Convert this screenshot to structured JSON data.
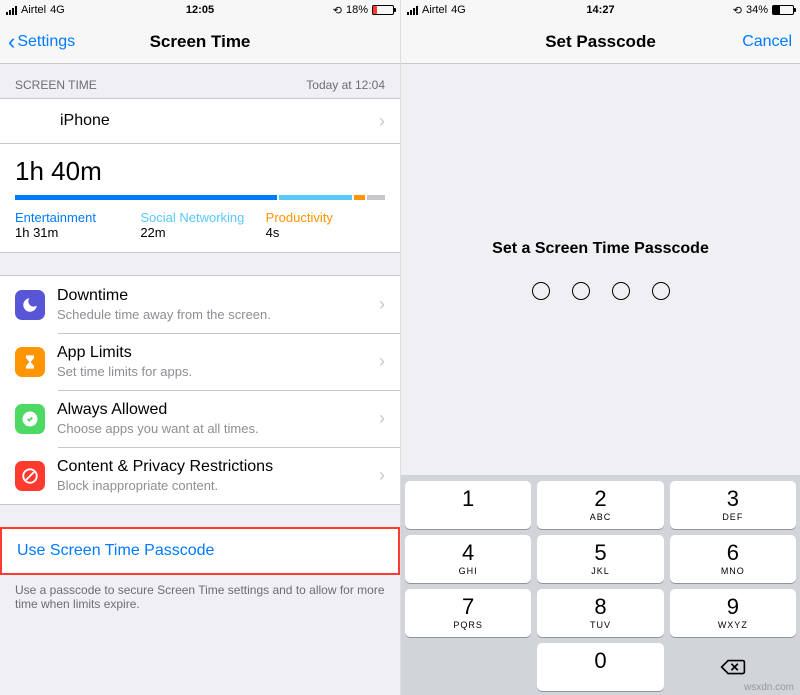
{
  "left": {
    "status": {
      "carrier": "Airtel",
      "net": "4G",
      "time": "12:05",
      "battery_pct": "18%"
    },
    "nav": {
      "back": "Settings",
      "title": "Screen Time"
    },
    "section": {
      "header": "SCREEN TIME",
      "timestamp": "Today at 12:04"
    },
    "device_row": {
      "label": "iPhone"
    },
    "usage": {
      "total": "1h 40m",
      "cats": [
        {
          "label": "Entertainment",
          "value": "1h 31m",
          "color": "#007aff",
          "flex": 72
        },
        {
          "label": "Social Networking",
          "value": "22m",
          "color": "#5ac8fa",
          "flex": 20
        },
        {
          "label": "Productivity",
          "value": "4s",
          "color": "#ff9500",
          "flex": 3
        }
      ]
    },
    "menu": [
      {
        "title": "Downtime",
        "sub": "Schedule time away from the screen.",
        "icon": "moon-icon",
        "color": "ico-purple"
      },
      {
        "title": "App Limits",
        "sub": "Set time limits for apps.",
        "icon": "hourglass-icon",
        "color": "ico-orange"
      },
      {
        "title": "Always Allowed",
        "sub": "Choose apps you want at all times.",
        "icon": "check-badge-icon",
        "color": "ico-green"
      },
      {
        "title": "Content & Privacy Restrictions",
        "sub": "Block inappropriate content.",
        "icon": "prohibited-icon",
        "color": "ico-red"
      }
    ],
    "passcode_link": "Use Screen Time Passcode",
    "passcode_footer": "Use a passcode to secure Screen Time settings and to allow for more time when limits expire."
  },
  "right": {
    "status": {
      "carrier": "Airtel",
      "net": "4G",
      "time": "14:27",
      "battery_pct": "34%"
    },
    "nav": {
      "title": "Set Passcode",
      "cancel": "Cancel"
    },
    "prompt": "Set a Screen Time Passcode",
    "keypad": [
      [
        {
          "n": "1",
          "l": ""
        },
        {
          "n": "2",
          "l": "ABC"
        },
        {
          "n": "3",
          "l": "DEF"
        }
      ],
      [
        {
          "n": "4",
          "l": "GHI"
        },
        {
          "n": "5",
          "l": "JKL"
        },
        {
          "n": "6",
          "l": "MNO"
        }
      ],
      [
        {
          "n": "7",
          "l": "PQRS"
        },
        {
          "n": "8",
          "l": "TUV"
        },
        {
          "n": "9",
          "l": "WXYZ"
        }
      ],
      [
        {
          "blank": true
        },
        {
          "n": "0",
          "l": ""
        },
        {
          "del": true
        }
      ]
    ]
  },
  "watermark": "wsxdn.com"
}
